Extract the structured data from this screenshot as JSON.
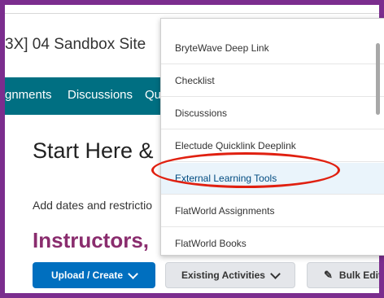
{
  "header": {
    "site_title": "3X] 04 Sandbox Site"
  },
  "navbar": {
    "items": [
      {
        "label": "gnments"
      },
      {
        "label": "Discussions"
      },
      {
        "label": "Qui"
      }
    ]
  },
  "main": {
    "heading": "Start Here &",
    "add_dates_text": "Add dates and restrictio",
    "instructors_heading": "Instructors,"
  },
  "toolbar": {
    "upload_label": "Upload / Create",
    "existing_label": "Existing Activities",
    "bulk_label": "Bulk Edit"
  },
  "dropdown": {
    "items": [
      {
        "label": "BryteWave Deep Link"
      },
      {
        "label": "Checklist"
      },
      {
        "label": "Discussions"
      },
      {
        "label": "Electude Quicklink Deeplink"
      },
      {
        "label": "External Learning Tools"
      },
      {
        "label": "FlatWorld Assignments"
      },
      {
        "label": "FlatWorld Books"
      }
    ]
  },
  "colors": {
    "frame_border": "#7b2d8e",
    "navbar": "#006f82",
    "primary_button": "#006fbf",
    "instructors_text": "#8a2d6e",
    "highlight_oval": "#e02010"
  }
}
